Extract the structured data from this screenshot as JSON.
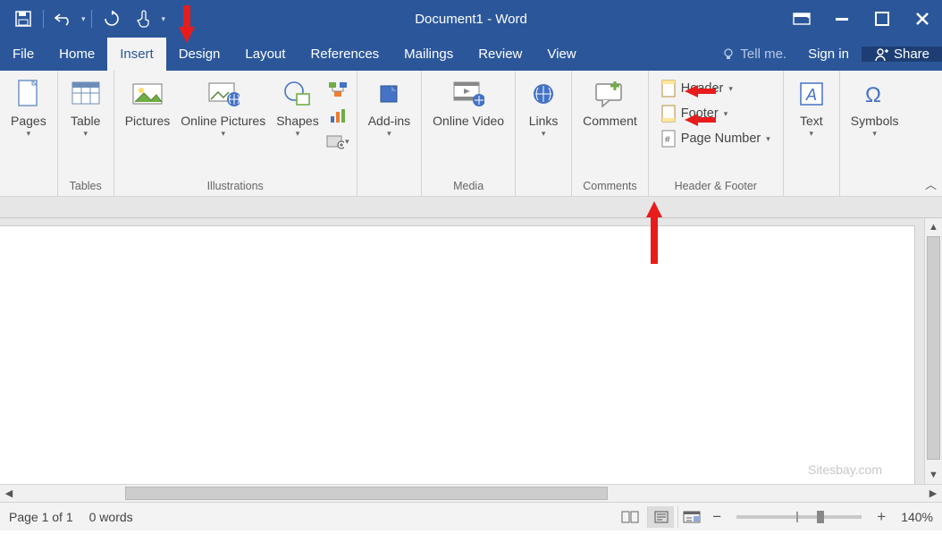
{
  "title": "Document1 - Word",
  "tabs": [
    "File",
    "Home",
    "Insert",
    "Design",
    "Layout",
    "References",
    "Mailings",
    "Review",
    "View"
  ],
  "active_tab": "Insert",
  "tellme": "Tell me.",
  "signin": "Sign in",
  "share": "Share",
  "ribbon": {
    "pages": {
      "label": "Pages"
    },
    "tables": {
      "btn": "Table",
      "group": "Tables"
    },
    "illus": {
      "pictures": "Pictures",
      "online_pictures": "Online Pictures",
      "shapes": "Shapes",
      "group": "Illustrations"
    },
    "addins": {
      "btn": "Add-ins"
    },
    "media": {
      "btn": "Online Video",
      "group": "Media"
    },
    "links": {
      "btn": "Links"
    },
    "comments": {
      "btn": "Comment",
      "group": "Comments"
    },
    "hf": {
      "header": "Header",
      "footer": "Footer",
      "pagenum": "Page Number",
      "group": "Header & Footer"
    },
    "text": {
      "btn": "Text"
    },
    "symbols": {
      "btn": "Symbols"
    }
  },
  "watermark": "Sitesbay.com",
  "status": {
    "page": "Page 1 of 1",
    "words": "0 words",
    "zoom": "140%"
  }
}
